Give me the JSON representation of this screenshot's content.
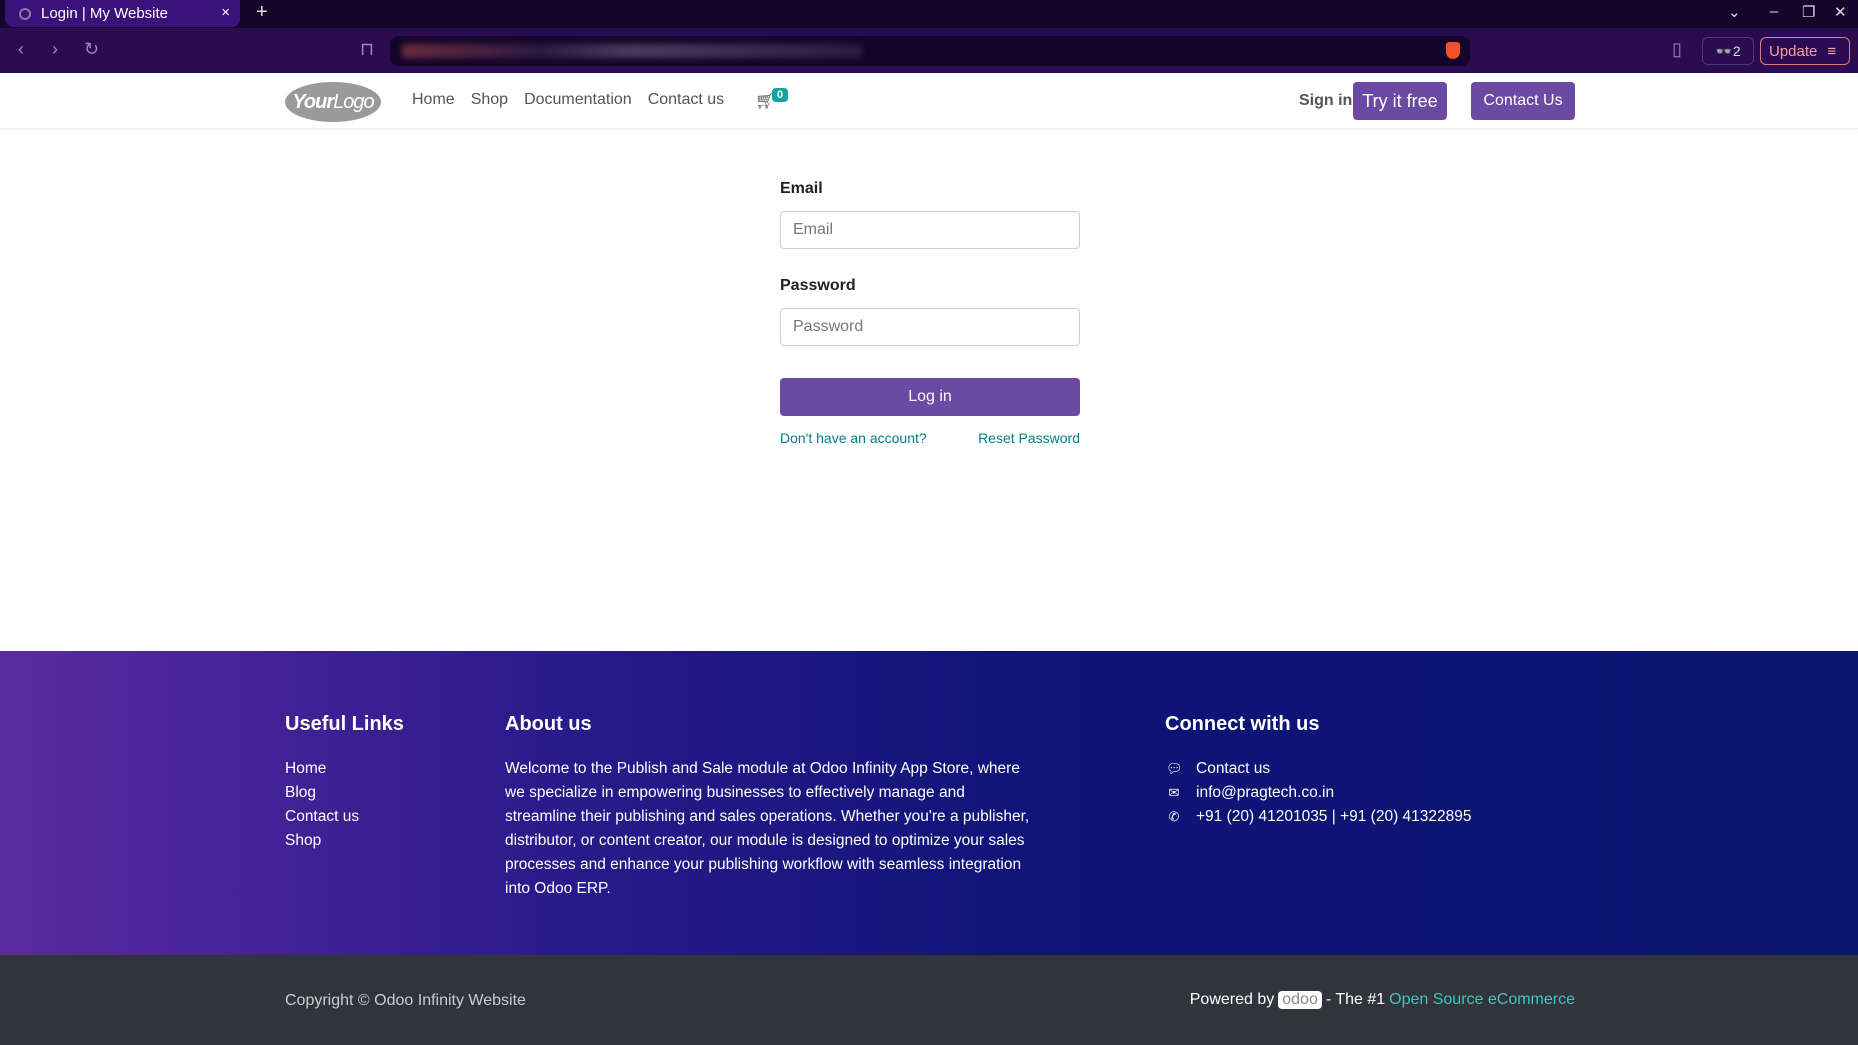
{
  "browser": {
    "tab_title": "Login | My Website",
    "ext_count": "2",
    "update_label": "Update"
  },
  "nav": {
    "logo": "YourLogo",
    "logo_a": "Your",
    "logo_b": "Logo",
    "items": [
      "Home",
      "Shop",
      "Documentation",
      "Contact us"
    ],
    "cart_count": "0",
    "sign_in": "Sign in",
    "try_free": "Try it free",
    "contact_us": "Contact Us"
  },
  "form": {
    "email_label": "Email",
    "email_placeholder": "Email",
    "email_value": "",
    "password_label": "Password",
    "password_placeholder": "Password",
    "password_value": "",
    "login_label": "Log in",
    "signup_link": "Don't have an account?",
    "reset_link": "Reset Password"
  },
  "footer": {
    "useful_title": "Useful Links",
    "useful_links": [
      "Home",
      "Blog",
      "Contact us",
      "Shop"
    ],
    "about_title": "About us",
    "about_text": "Welcome to the Publish and Sale module at Odoo Infinity App Store, where we specialize in empowering businesses to effectively manage and streamline their publishing and sales operations. Whether you're a publisher, distributor, or content creator, our module is designed to optimize your sales processes and enhance your publishing workflow with seamless integration into Odoo ERP.",
    "connect_title": "Connect with us",
    "contact": "Contact us",
    "email": "info@pragtech.co.in",
    "phone": "+91 (20) 41201035 | +91 (20) 41322895"
  },
  "bottom": {
    "copyright": "Copyright © Odoo Infinity Website",
    "powered": "Powered by",
    "odoo": "odoo",
    "the1": "- The #1",
    "oss": "Open Source eCommerce"
  },
  "colors": {
    "primary": "#6a4aa3",
    "link": "#017e84",
    "footer_bg": "#0f1478",
    "bottom_bg": "#31343b"
  }
}
